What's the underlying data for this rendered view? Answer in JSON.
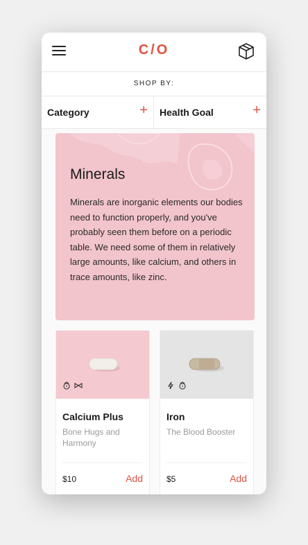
{
  "header": {
    "logo": "C/O",
    "menu_icon": "hamburger-menu-icon",
    "cart_icon": "box-icon"
  },
  "shop_by": "SHOP BY:",
  "filters": [
    {
      "label": "Category",
      "icon": "plus-icon"
    },
    {
      "label": "Health Goal",
      "icon": "plus-icon"
    }
  ],
  "hero": {
    "title": "Minerals",
    "description": "Minerals are inorganic elements our bodies need to function properly, and you've probably seen them before on a periodic table. We need some of them in relatively large amounts, like calcium, and others in trace amounts, like zinc."
  },
  "products": [
    {
      "name": "Calcium Plus",
      "tagline": "Bone Hugs and Harmony",
      "price": "$10",
      "add": "Add",
      "icons": [
        "bone-icon",
        "balance-icon"
      ],
      "color": "#f4c9cf"
    },
    {
      "name": "Iron",
      "tagline": "The Blood Booster",
      "price": "$5",
      "add": "Add",
      "icons": [
        "energy-icon",
        "drop-icon"
      ],
      "color": "#e4e4e4"
    }
  ],
  "colors": {
    "accent": "#e0533f",
    "hero_bg": "#f2c4cb"
  }
}
